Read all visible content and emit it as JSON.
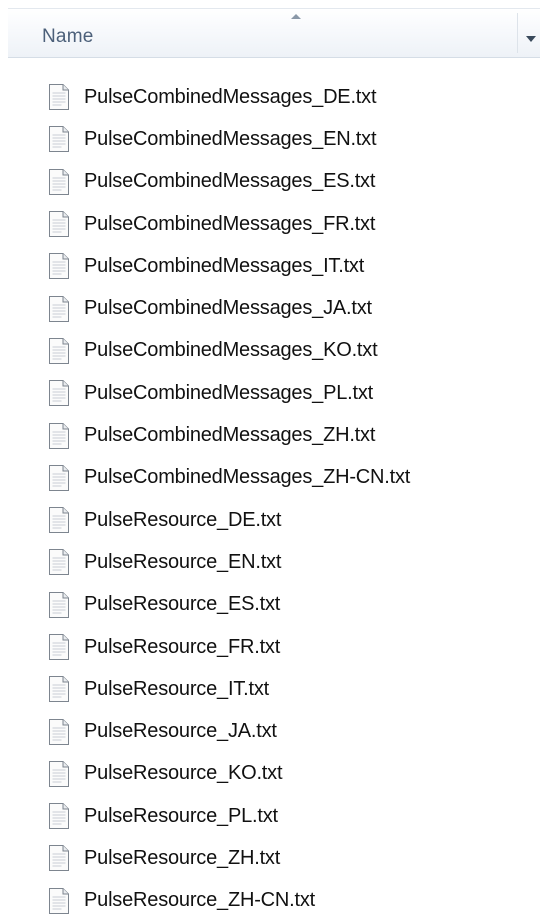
{
  "header": {
    "column_title": "Name",
    "sort_direction": "ascending"
  },
  "files": [
    {
      "name": "PulseCombinedMessages_DE.txt",
      "icon": "text-file-icon"
    },
    {
      "name": "PulseCombinedMessages_EN.txt",
      "icon": "text-file-icon"
    },
    {
      "name": "PulseCombinedMessages_ES.txt",
      "icon": "text-file-icon"
    },
    {
      "name": "PulseCombinedMessages_FR.txt",
      "icon": "text-file-icon"
    },
    {
      "name": "PulseCombinedMessages_IT.txt",
      "icon": "text-file-icon"
    },
    {
      "name": "PulseCombinedMessages_JA.txt",
      "icon": "text-file-icon"
    },
    {
      "name": "PulseCombinedMessages_KO.txt",
      "icon": "text-file-icon"
    },
    {
      "name": "PulseCombinedMessages_PL.txt",
      "icon": "text-file-icon"
    },
    {
      "name": "PulseCombinedMessages_ZH.txt",
      "icon": "text-file-icon"
    },
    {
      "name": "PulseCombinedMessages_ZH-CN.txt",
      "icon": "text-file-icon"
    },
    {
      "name": "PulseResource_DE.txt",
      "icon": "text-file-icon"
    },
    {
      "name": "PulseResource_EN.txt",
      "icon": "text-file-icon"
    },
    {
      "name": "PulseResource_ES.txt",
      "icon": "text-file-icon"
    },
    {
      "name": "PulseResource_FR.txt",
      "icon": "text-file-icon"
    },
    {
      "name": "PulseResource_IT.txt",
      "icon": "text-file-icon"
    },
    {
      "name": "PulseResource_JA.txt",
      "icon": "text-file-icon"
    },
    {
      "name": "PulseResource_KO.txt",
      "icon": "text-file-icon"
    },
    {
      "name": "PulseResource_PL.txt",
      "icon": "text-file-icon"
    },
    {
      "name": "PulseResource_ZH.txt",
      "icon": "text-file-icon"
    },
    {
      "name": "PulseResource_ZH-CN.txt",
      "icon": "text-file-icon"
    }
  ]
}
